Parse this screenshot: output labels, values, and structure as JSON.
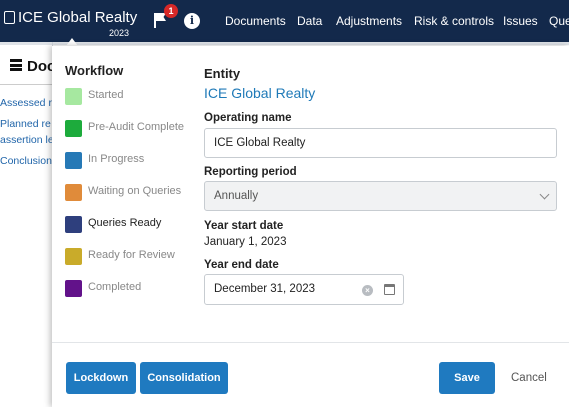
{
  "header": {
    "app_title": "ICE Global Realty",
    "year": "2023",
    "notification_count": "1",
    "nav": [
      "Documents",
      "Data",
      "Adjustments",
      "Risk & controls",
      "Issues",
      "Que"
    ]
  },
  "background": {
    "heading": "Doc",
    "links": [
      "Assessed r",
      "Planned re",
      "assertion le",
      "Conclusion"
    ]
  },
  "workflow": {
    "title": "Workflow",
    "items": [
      {
        "label": "Started",
        "color": "#a6e8a0",
        "active": false
      },
      {
        "label": "Pre-Audit Complete",
        "color": "#1dab3c",
        "active": false
      },
      {
        "label": "In Progress",
        "color": "#2679b6",
        "active": false
      },
      {
        "label": "Waiting on Queries",
        "color": "#e08b3a",
        "active": false
      },
      {
        "label": "Queries Ready",
        "color": "#2e3f7d",
        "active": true
      },
      {
        "label": "Ready for Review",
        "color": "#c9ab2a",
        "active": false
      },
      {
        "label": "Completed",
        "color": "#62128a",
        "active": false
      }
    ]
  },
  "form": {
    "entity_label": "Entity",
    "entity_name": "ICE Global Realty",
    "operating_name_label": "Operating name",
    "operating_name_value": "ICE Global Realty",
    "reporting_period_label": "Reporting period",
    "reporting_period_value": "Annually",
    "year_start_label": "Year start date",
    "year_start_value": "January 1, 2023",
    "year_end_label": "Year end date",
    "year_end_value": "December 31, 2023"
  },
  "footer": {
    "lockdown_label": "Lockdown",
    "consolidation_label": "Consolidation",
    "save_label": "Save",
    "cancel_label": "Cancel"
  },
  "colors": {
    "nav_bg": "#13294b",
    "accent": "#1f7ac0",
    "link": "#1f7ab8"
  }
}
